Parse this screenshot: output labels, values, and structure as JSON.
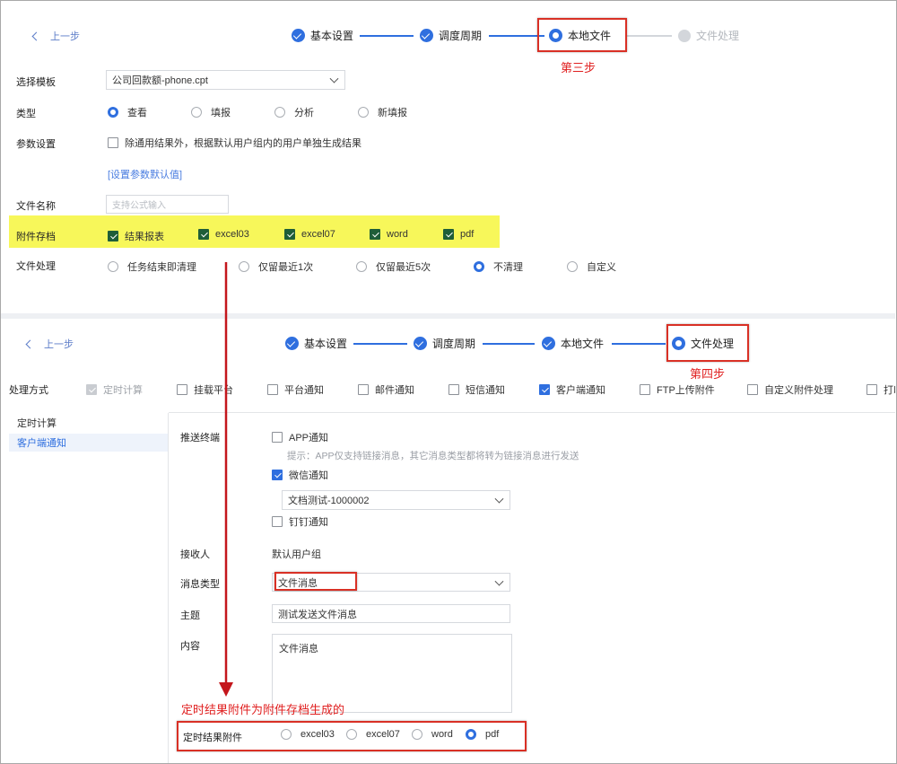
{
  "top": {
    "back_label": "上一步",
    "steps": [
      {
        "label": "基本设置",
        "state": "done"
      },
      {
        "label": "调度周期",
        "state": "done"
      },
      {
        "label": "本地文件",
        "state": "current"
      },
      {
        "label": "文件处理",
        "state": "pending"
      }
    ],
    "annotation": "第三步",
    "form": {
      "template_label": "选择模板",
      "template_value": "公司回款额-phone.cpt",
      "type_label": "类型",
      "type_options": [
        "查看",
        "填报",
        "分析",
        "新填报"
      ],
      "type_selected": "查看",
      "param_label": "参数设置",
      "param_checkbox": "除通用结果外，根据默认用户组内的用户单独生成结果",
      "param_link": "[设置参数默认值]",
      "filename_label": "文件名称",
      "filename_placeholder": "支持公式输入",
      "archive_label": "附件存档",
      "archive_options": [
        "结果报表",
        "excel03",
        "excel07",
        "word",
        "pdf"
      ],
      "handle_label": "文件处理",
      "handle_options": [
        "任务结束即清理",
        "仅留最近1次",
        "仅留最近5次",
        "不清理",
        "自定义"
      ],
      "handle_selected": "不清理"
    }
  },
  "bottom": {
    "back_label": "上一步",
    "steps": [
      {
        "label": "基本设置",
        "state": "done"
      },
      {
        "label": "调度周期",
        "state": "done"
      },
      {
        "label": "本地文件",
        "state": "done"
      },
      {
        "label": "文件处理",
        "state": "current"
      }
    ],
    "annotation": "第四步",
    "method_label": "处理方式",
    "methods": [
      {
        "label": "定时计算",
        "checked": true,
        "disabled": true
      },
      {
        "label": "挂载平台",
        "checked": false
      },
      {
        "label": "平台通知",
        "checked": false
      },
      {
        "label": "邮件通知",
        "checked": false
      },
      {
        "label": "短信通知",
        "checked": false
      },
      {
        "label": "客户端通知",
        "checked": true
      },
      {
        "label": "FTP上传附件",
        "checked": false
      },
      {
        "label": "自定义附件处理",
        "checked": false
      },
      {
        "label": "打印",
        "checked": false
      }
    ],
    "sidebar": [
      "定时计算",
      "客户端通知"
    ],
    "push_label": "推送终端",
    "app_label": "APP通知",
    "tip": "提示：APP仅支持链接消息，其它消息类型都将转为链接消息进行发送",
    "wechat_label": "微信通知",
    "wechat_select": "文档测试-1000002",
    "dingtalk_label": "钉钉通知",
    "receiver_label": "接收人",
    "receiver_value": "默认用户组",
    "msgtype_label": "消息类型",
    "msgtype_value": "文件消息",
    "subject_label": "主题",
    "subject_value": "测试发送文件消息",
    "content_label": "内容",
    "content_value": "文件消息",
    "attach_note": "定时结果附件为附件存档生成的",
    "attach_label": "定时结果附件",
    "attach_options": [
      "excel03",
      "excel07",
      "word",
      "pdf"
    ],
    "attach_selected": "pdf"
  },
  "colors": {
    "accent": "#2f6fdf",
    "highlight": "#f7f75a",
    "annotation": "#e02020"
  }
}
